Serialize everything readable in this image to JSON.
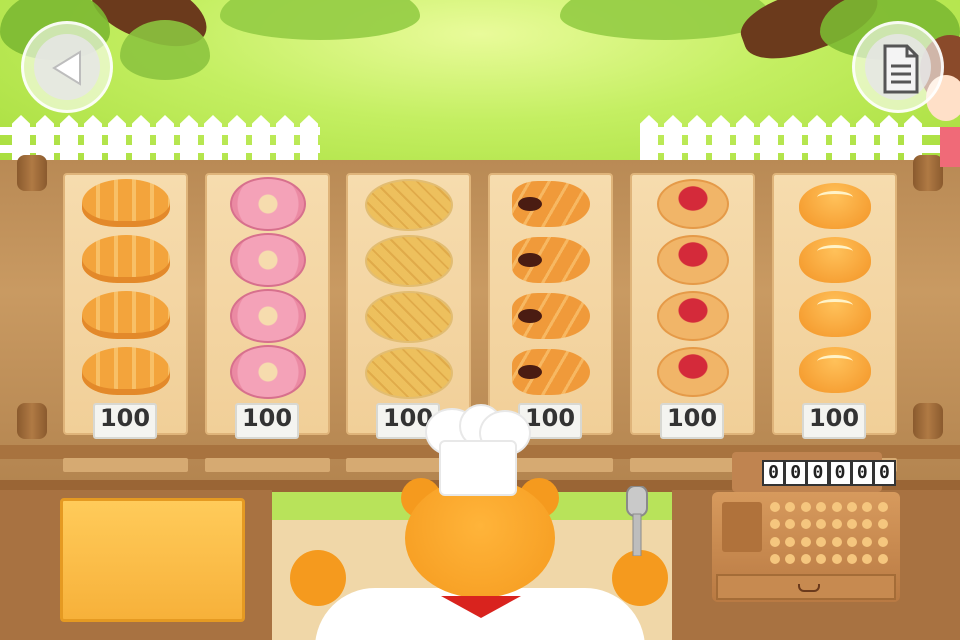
{
  "game": {
    "screen": "bakery-shop",
    "buttons": {
      "back_icon": "triangle-left-icon",
      "menu_icon": "document-icon"
    },
    "products": [
      {
        "name": "croissant",
        "price": "100",
        "count": 4
      },
      {
        "name": "donut",
        "price": "100",
        "count": 4
      },
      {
        "name": "melon-bread",
        "price": "100",
        "count": 4
      },
      {
        "name": "chocolate-cornet",
        "price": "100",
        "count": 4
      },
      {
        "name": "jam-bread",
        "price": "100",
        "count": 4
      },
      {
        "name": "bun",
        "price": "100",
        "count": 4
      }
    ],
    "register": {
      "digits": [
        "0",
        "0",
        "0",
        "0",
        "0",
        "0"
      ]
    },
    "colors": {
      "grass": "#b8e35a",
      "wood": "#a87241",
      "tray": "#f1cf98",
      "board": "#f7b13a"
    }
  }
}
